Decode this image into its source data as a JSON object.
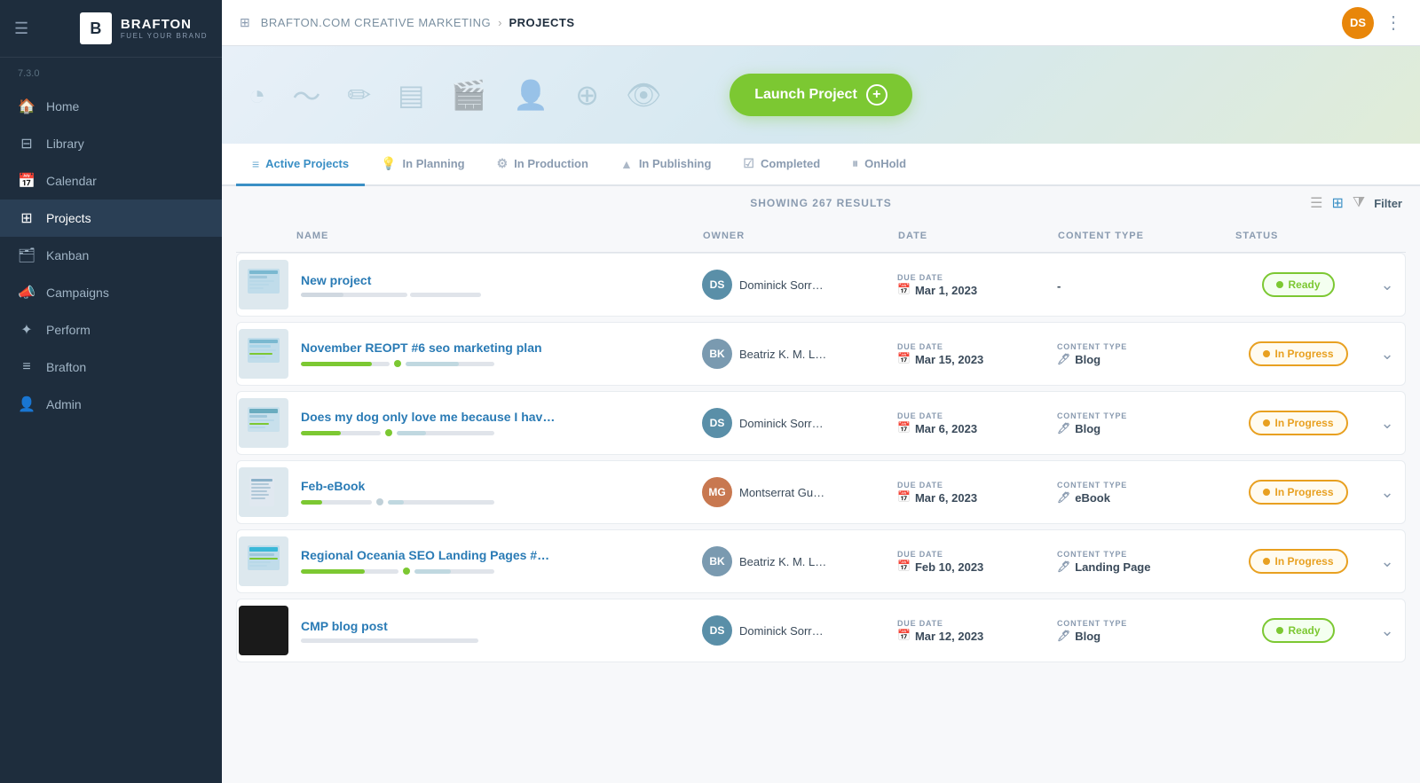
{
  "app": {
    "version": "7.3.0",
    "brand": "BRAFTON",
    "tagline": "FUEL YOUR BRAND",
    "logo_letter": "B"
  },
  "topbar": {
    "company": "BRAFTON.COM CREATIVE MARKETING",
    "breadcrumb_sep": "›",
    "page": "PROJECTS",
    "user_initials": "DS"
  },
  "nav": {
    "items": [
      {
        "label": "Home",
        "icon": "🏠",
        "active": false
      },
      {
        "label": "Library",
        "icon": "📚",
        "active": false
      },
      {
        "label": "Calendar",
        "icon": "📅",
        "active": false
      },
      {
        "label": "Projects",
        "icon": "⊞",
        "active": true
      },
      {
        "label": "Kanban",
        "icon": "🗂",
        "active": false
      },
      {
        "label": "Campaigns",
        "icon": "📣",
        "active": false
      },
      {
        "label": "Perform",
        "icon": "✦",
        "active": false
      },
      {
        "label": "Brafton",
        "icon": "≡",
        "active": false
      },
      {
        "label": "Admin",
        "icon": "👤",
        "active": false
      }
    ]
  },
  "banner": {
    "launch_btn_label": "Launch Project",
    "plus": "+"
  },
  "tabs": [
    {
      "label": "Active Projects",
      "icon": "≡",
      "active": true
    },
    {
      "label": "In Planning",
      "icon": "💡",
      "active": false
    },
    {
      "label": "In Production",
      "icon": "⚙",
      "active": false
    },
    {
      "label": "In Publishing",
      "icon": "▲",
      "active": false
    },
    {
      "label": "Completed",
      "icon": "☑",
      "active": false
    },
    {
      "label": "OnHold",
      "icon": "⏸",
      "active": false
    }
  ],
  "results": {
    "showing": "SHOWING 267 RESULTS"
  },
  "table": {
    "headers": [
      "",
      "NAME",
      "OWNER",
      "DATE",
      "CONTENT TYPE",
      "STATUS",
      ""
    ],
    "rows": [
      {
        "id": 1,
        "name": "New project",
        "owner": "Dominick Sorr…",
        "owner_color": "#5a8fa8",
        "owner_initials": "DS",
        "date_label": "DUE DATE",
        "date": "Mar 1, 2023",
        "content_type_label": "",
        "content_type": "-",
        "status": "Ready",
        "status_type": "ready",
        "thumb_type": "web",
        "progress": [
          40,
          0
        ]
      },
      {
        "id": 2,
        "name": "November REOPT #6 seo marketing plan",
        "owner": "Beatriz K. M. L…",
        "owner_color": "#7a9ab0",
        "owner_initials": "BK",
        "date_label": "DUE DATE",
        "date": "Mar 15, 2023",
        "content_type_label": "CONTENT TYPE",
        "content_type": "Blog",
        "status": "In Progress",
        "status_type": "in-progress",
        "thumb_type": "web",
        "progress": [
          80,
          60
        ]
      },
      {
        "id": 3,
        "name": "Does my dog only love me because I hav…",
        "owner": "Dominick Sorr…",
        "owner_color": "#5a8fa8",
        "owner_initials": "DS",
        "date_label": "DUE DATE",
        "date": "Mar 6, 2023",
        "content_type_label": "CONTENT TYPE",
        "content_type": "Blog",
        "status": "In Progress",
        "status_type": "in-progress",
        "thumb_type": "web",
        "progress": [
          50,
          30
        ]
      },
      {
        "id": 4,
        "name": "Feb-eBook",
        "owner": "Montserrat Gu…",
        "owner_color": "#c87850",
        "owner_initials": "MG",
        "date_label": "DUE DATE",
        "date": "Mar 6, 2023",
        "content_type_label": "CONTENT TYPE",
        "content_type": "eBook",
        "status": "In Progress",
        "status_type": "in-progress",
        "thumb_type": "doc",
        "progress": [
          30,
          15
        ]
      },
      {
        "id": 5,
        "name": "Regional Oceania SEO Landing Pages #…",
        "owner": "Beatriz K. M. L…",
        "owner_color": "#7a9ab0",
        "owner_initials": "BK",
        "date_label": "DUE DATE",
        "date": "Feb 10, 2023",
        "content_type_label": "CONTENT TYPE",
        "content_type": "Landing Page",
        "status": "In Progress",
        "status_type": "in-progress",
        "thumb_type": "web",
        "progress": [
          65,
          45
        ]
      },
      {
        "id": 6,
        "name": "CMP blog post",
        "owner": "Dominick Sorr…",
        "owner_color": "#5a8fa8",
        "owner_initials": "DS",
        "date_label": "DUE DATE",
        "date": "Mar 12, 2023",
        "content_type_label": "CONTENT TYPE",
        "content_type": "Blog",
        "status": "Ready",
        "status_type": "ready",
        "thumb_type": "dark",
        "progress": [
          0,
          0
        ]
      }
    ]
  }
}
